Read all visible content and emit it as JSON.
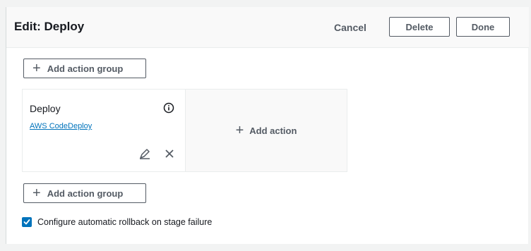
{
  "header": {
    "title": "Edit: Deploy",
    "cancel_label": "Cancel",
    "delete_label": "Delete",
    "done_label": "Done"
  },
  "add_action_group_label": "Add action group",
  "action_group": {
    "action": {
      "name": "Deploy",
      "provider": "AWS CodeDeploy"
    },
    "add_action_label": "Add action"
  },
  "rollback": {
    "label": "Configure automatic rollback on stage failure",
    "checked": true
  },
  "colors": {
    "accent": "#0073bb",
    "button_border": "#545b64",
    "header_bg": "#f9f9f9"
  }
}
